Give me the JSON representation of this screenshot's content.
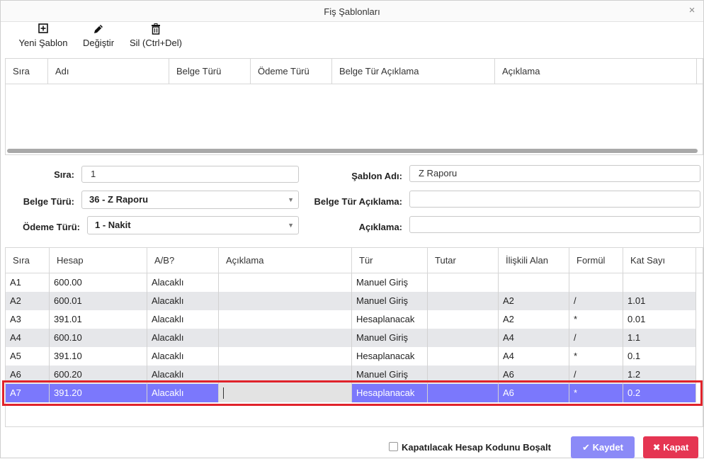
{
  "window": {
    "title": "Fiş Şablonları",
    "close_glyph": "×"
  },
  "toolbar": {
    "new_label": "Yeni Şablon",
    "new_icon": "plus-square-icon",
    "edit_label": "Değiştir",
    "edit_icon": "pencil-icon",
    "delete_label": "Sil (Ctrl+Del)",
    "delete_icon": "trash-icon"
  },
  "templates_grid": {
    "columns": [
      "Sıra",
      "Adı",
      "Belge Türü",
      "Ödeme Türü",
      "Belge Tür Açıklama",
      "Açıklama"
    ],
    "rows": []
  },
  "form": {
    "sira_label": "Sıra:",
    "sira_value": "1",
    "belge_turu_label": "Belge Türü:",
    "belge_turu_value": "36 - Z Raporu",
    "odeme_turu_label": "Ödeme Türü:",
    "odeme_turu_value": "1 - Nakit",
    "sablon_adi_label": "Şablon Adı:",
    "sablon_adi_value": "Z Raporu",
    "belge_tur_aciklama_label": "Belge Tür Açıklama:",
    "belge_tur_aciklama_value": "",
    "aciklama_label": "Açıklama:",
    "aciklama_value": ""
  },
  "lines_grid": {
    "columns": [
      "Sıra",
      "Hesap",
      "A/B?",
      "Açıklama",
      "Tür",
      "Tutar",
      "İlişkili Alan",
      "Formül",
      "Kat Sayı"
    ],
    "rows": [
      [
        "A1",
        "600.00",
        "Alacaklı",
        "",
        "Manuel Giriş",
        "",
        "",
        "",
        ""
      ],
      [
        "A2",
        "600.01",
        "Alacaklı",
        "",
        "Manuel Giriş",
        "",
        "A2",
        "/",
        "1.01"
      ],
      [
        "A3",
        "391.01",
        "Alacaklı",
        "",
        "Hesaplanacak",
        "",
        "A2",
        "*",
        "0.01"
      ],
      [
        "A4",
        "600.10",
        "Alacaklı",
        "",
        "Manuel Giriş",
        "",
        "A4",
        "/",
        "1.1"
      ],
      [
        "A5",
        "391.10",
        "Alacaklı",
        "",
        "Hesaplanacak",
        "",
        "A4",
        "*",
        "0.1"
      ],
      [
        "A6",
        "600.20",
        "Alacaklı",
        "",
        "Manuel Giriş",
        "",
        "A6",
        "/",
        "1.2"
      ],
      [
        "A7",
        "391.20",
        "Alacaklı",
        "",
        "Hesaplanacak",
        "",
        "A6",
        "*",
        "0.2"
      ]
    ],
    "selected_row": 6,
    "colors": {
      "selected": "#7b78fc",
      "alt_row": "#e6e7ea",
      "highlight": "#e0232b"
    }
  },
  "footer": {
    "checkbox_label": "Kapatılacak Hesap Kodunu Boşalt",
    "checkbox_checked": false,
    "save_label": "Kaydet",
    "close_label": "Kapat",
    "save_color": "#8b8af7",
    "close_color": "#e53552"
  }
}
